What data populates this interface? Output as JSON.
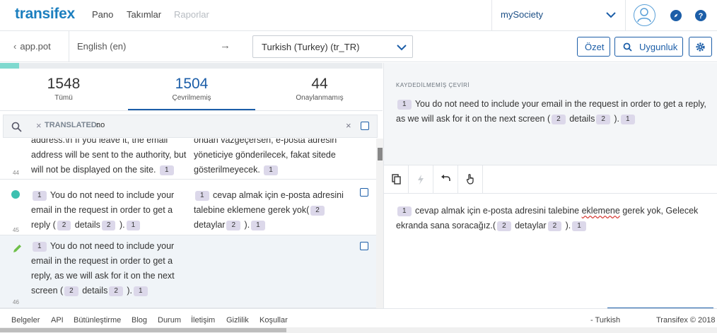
{
  "app": {
    "logo": "transifex"
  },
  "nav": {
    "items": [
      "Pano",
      "Takımlar",
      "Raporlar"
    ]
  },
  "org": {
    "name": "mySociety"
  },
  "subbar": {
    "back_label": "app.pot",
    "source_lang": "English (en)",
    "arrow": "→",
    "target_lang": "Turkish (Turkey) (tr_TR)",
    "summary_btn": "Özet",
    "check_btn": "Uygunluk"
  },
  "progress": {
    "fraction": 0.05
  },
  "tabs": [
    {
      "count": "1548",
      "label": "Tümü"
    },
    {
      "count": "1504",
      "label": "Çevrilmemiş"
    },
    {
      "count": "44",
      "label": "Onaylanmamış"
    }
  ],
  "filter": {
    "remove": "×",
    "key": "TRANSLATED:",
    "value": "no",
    "clear": "×"
  },
  "rows": [
    {
      "num": "44",
      "src_lines": [
        "address.\\n If you leave it, the email",
        "address will be sent to the authority, but",
        "will not be displayed on the site."
      ],
      "src_tag": "1",
      "trg_lines": [
        "ondan vazgeçersen, e-posta adresin",
        "yöneticiye gönderilecek, fakat sitede",
        "gösterilmeyecek."
      ],
      "trg_tag": "1"
    },
    {
      "num": "45",
      "src": [
        "You do not need to include your",
        "email in the request in order to get a",
        "reply (",
        "details",
        ")."
      ],
      "trg": [
        "cevap almak için e-posta adresini",
        "talebine eklemene gerek yok(",
        "detaylar",
        ")."
      ]
    },
    {
      "num": "46",
      "src": [
        "You do not need to include your",
        "email in the request in order to get a",
        "reply, as we will ask for it on the next",
        "screen (",
        "details",
        ")."
      ]
    }
  ],
  "tags": {
    "one": "1",
    "two": "2"
  },
  "source_panel": {
    "caption": "KAYDEDİLMEMİŞ ÇEVİRİ",
    "text_a": "You do not need to include your email in the request in order to get a reply,",
    "text_b": "as we will ask for it on the next screen (",
    "text_c": "details",
    "text_d": ")."
  },
  "target_panel": {
    "text_a": "cevap almak için e-posta adresini talebine",
    "text_err": "eklemene",
    "text_b": "gerek yok, Gelecek",
    "text_c": "ekranda sana soracağız.(",
    "text_d": "detaylar",
    "text_e": ")."
  },
  "footer": {
    "links": [
      "Belgeler",
      "API",
      "Bütünleştirme",
      "Blog",
      "Durum",
      "İletişim",
      "Gizlilik",
      "Koşullar"
    ],
    "language": "- Turkish",
    "copyright": "Transifex © 2018"
  },
  "colors": {
    "brand": "#1c7fbf",
    "accent": "#1c5ea8",
    "tag": "#dcd8ea",
    "progress": "#7fd9cf",
    "status_dot": "#3cc0b0",
    "edit": "#6fbf4a"
  }
}
